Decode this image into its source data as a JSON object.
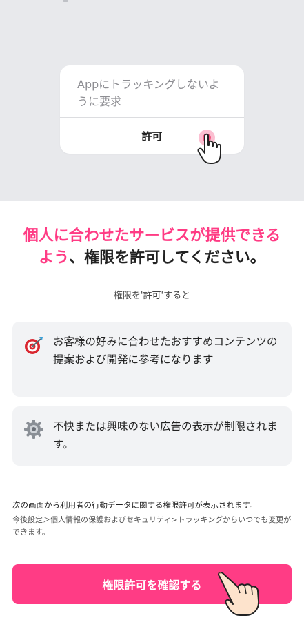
{
  "dialog": {
    "message": "Appにトラッキングしないように要求",
    "allow_label": "許可"
  },
  "headline": {
    "part1_pink": "個人に合わせたサービスが提供できる",
    "part2_pink": "よう",
    "part3": "、権限を許可してください。"
  },
  "subhead": "権限を'許可'すると",
  "benefits": [
    {
      "icon": "target-icon",
      "text": "お客様の好みに合わせたおすすめコンテンツの提案および開発に参考になります"
    },
    {
      "icon": "gear-icon",
      "text": "不快または興味のない広告の表示が制限されます。"
    }
  ],
  "notice": {
    "line1": "次の画面から利用者の行動データに関する権限許可が表示されます。",
    "line2": "今後設定＞個人情報の保護およびセキュリティ>トラッキングからいつでも変更ができます。"
  },
  "confirm_button": "権限許可を確認する",
  "colors": {
    "accent": "#ff3c85",
    "headline_pink": "#ff3b84",
    "top_background": "#e8e9ec",
    "card_background": "#f2f3f5"
  }
}
